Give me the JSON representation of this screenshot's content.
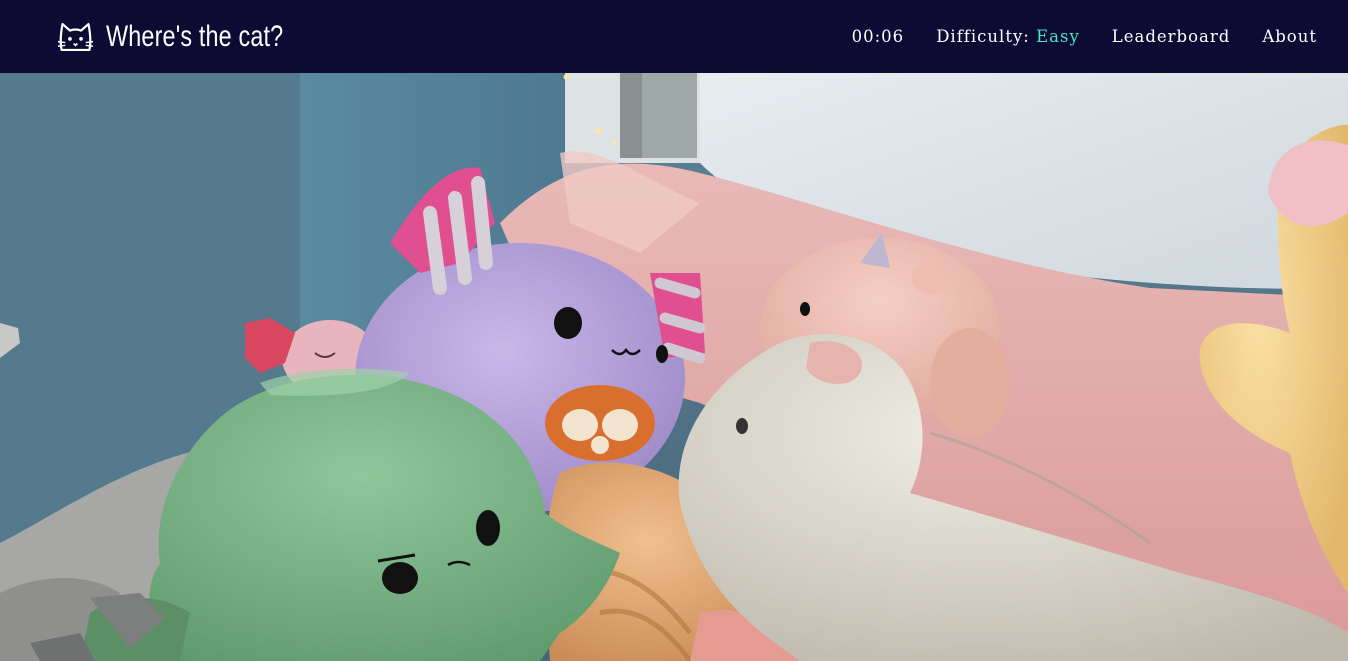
{
  "app": {
    "title": "Where's the cat?",
    "logo_icon": "cat-face-icon"
  },
  "nav": {
    "timer": "00:06",
    "difficulty_label": "Difficulty:",
    "difficulty_value": "Easy",
    "leaderboard": "Leaderboard",
    "about": "About"
  },
  "colors": {
    "navbar_bg": "#0d0a33",
    "accent": "#4ee3c1",
    "text": "#ffffff"
  },
  "scene": {
    "description": "Find-the-cat puzzle photo: plush toys on a bed hiding a sleeping orange cat"
  }
}
